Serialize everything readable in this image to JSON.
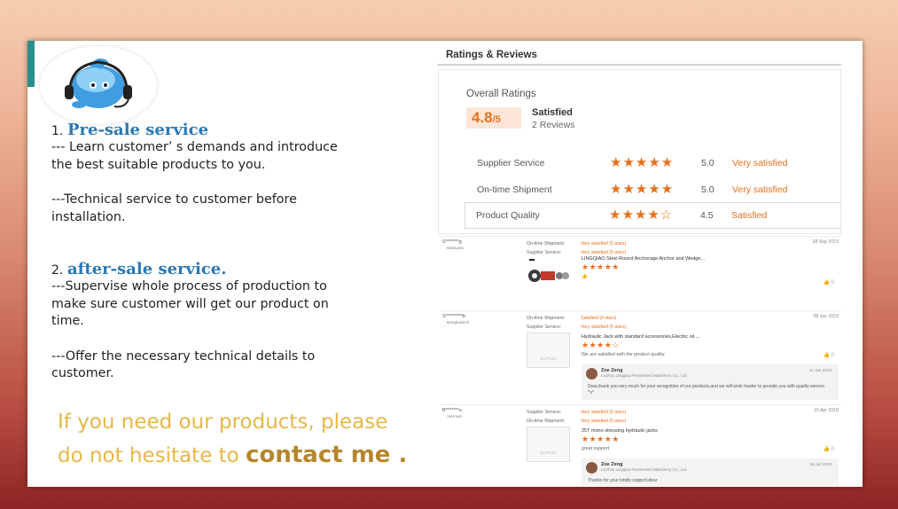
{
  "left": {
    "sec1_num": "1.",
    "sec1_title": "Pre-sale service",
    "sec1_p1_l1": " --- Learn customer’ s demands and introduce",
    "sec1_p1_l2": "the best suitable products to you.",
    "sec1_p2_l1": "---Technical service to customer before",
    "sec1_p2_l2": "installation.",
    "sec2_num": "2.",
    "sec2_title": "after-sale service.",
    "sec2_p1_l1": "---Supervise whole process of production to",
    "sec2_p1_l2": "make sure customer will get our product on",
    "sec2_p1_l3": "time.",
    "sec2_p2_l1": "---Offer the necessary technical details to",
    "sec2_p2_l2": "customer.",
    "cta_l1": "If you need our products, please",
    "cta_l2a": "do not hesitate to ",
    "cta_l2b": "contact me ."
  },
  "reviews": {
    "heading": "Ratings & Reviews",
    "overall_label": "Overall Ratings",
    "score": "4.8",
    "score_of": "/5",
    "satisfied": "Satisfied",
    "review_count": "2 Reviews",
    "rows": [
      {
        "label": "Supplier Service",
        "stars": "★★★★★",
        "value": "5.0",
        "text": "Very satisfied"
      },
      {
        "label": "On-time Shipment",
        "stars": "★★★★★",
        "value": "5.0",
        "text": "Very satisfied"
      },
      {
        "label": "Product Quality",
        "stars": "★★★★☆",
        "value": "4.5",
        "text": "Satisfied"
      }
    ],
    "items": [
      {
        "name": "S*******g",
        "country": "Malaysia",
        "meta_labels": [
          "On-time Shipment:",
          "Supplier Service:"
        ],
        "meta_values": [
          "Very satisfied  (5 stars)",
          "Very satisfied  (5 stars)"
        ],
        "date": "28 Sep 2019",
        "product": "LINGQIAO Steel Round Anchorage Anchor and Wedge...",
        "stars": "★★★★★",
        "comment": "👍",
        "likes": "👍 0"
      },
      {
        "name": "S*********b",
        "country": "Bangladesh",
        "meta_labels": [
          "On-time Shipment:",
          "Supplier Service:"
        ],
        "meta_values": [
          "Satisfied  (4 stars)",
          "Very satisfied  (5 stars)"
        ],
        "date": "08 Jan 2019",
        "thumb": "No Photo",
        "product": "Hydraulic Jack with standard accessories,Electric oil ...",
        "stars": "★★★★☆",
        "comment": "We are satisfied with the product quality.",
        "likes": "👍 0",
        "reply_name": "Zoe Zeng",
        "reply_company": "Liuzhou Lingqiao Prestressed Machinery Co., Ltd.",
        "reply_date": "11 Jan 2019",
        "reply_text": "Dear,thank you very much for your recognition of our products,and we will work harder to provide you with quality service. ^v^"
      },
      {
        "name": "B*******u",
        "country": "Vietnam",
        "meta_labels": [
          "Supplier Service:",
          "On-time Shipment:"
        ],
        "meta_values": [
          "Very satisfied  (5 stars)",
          "Very satisfied  (5 stars)"
        ],
        "date": "15 Apr 2018",
        "thumb": "No Photo",
        "product": "25T mono stressing hydraulic jacks",
        "stars": "★★★★★",
        "comment": "great support",
        "likes": "👍 0",
        "reply_name": "Zoe Zeng",
        "reply_company": "Liuzhou Lingqiao Prestressed Machinery Co., Ltd.",
        "reply_date": "15 Apr 2018",
        "reply_text": "Thanks for your kindly support,dear"
      }
    ]
  },
  "colors": {
    "accent_blue": "#2a78b5",
    "accent_orange": "#e7701d",
    "cta_gold": "#e6b84a"
  },
  "icons": {
    "logo": "headset-mascot-icon",
    "like": "thumbs-up-icon"
  }
}
